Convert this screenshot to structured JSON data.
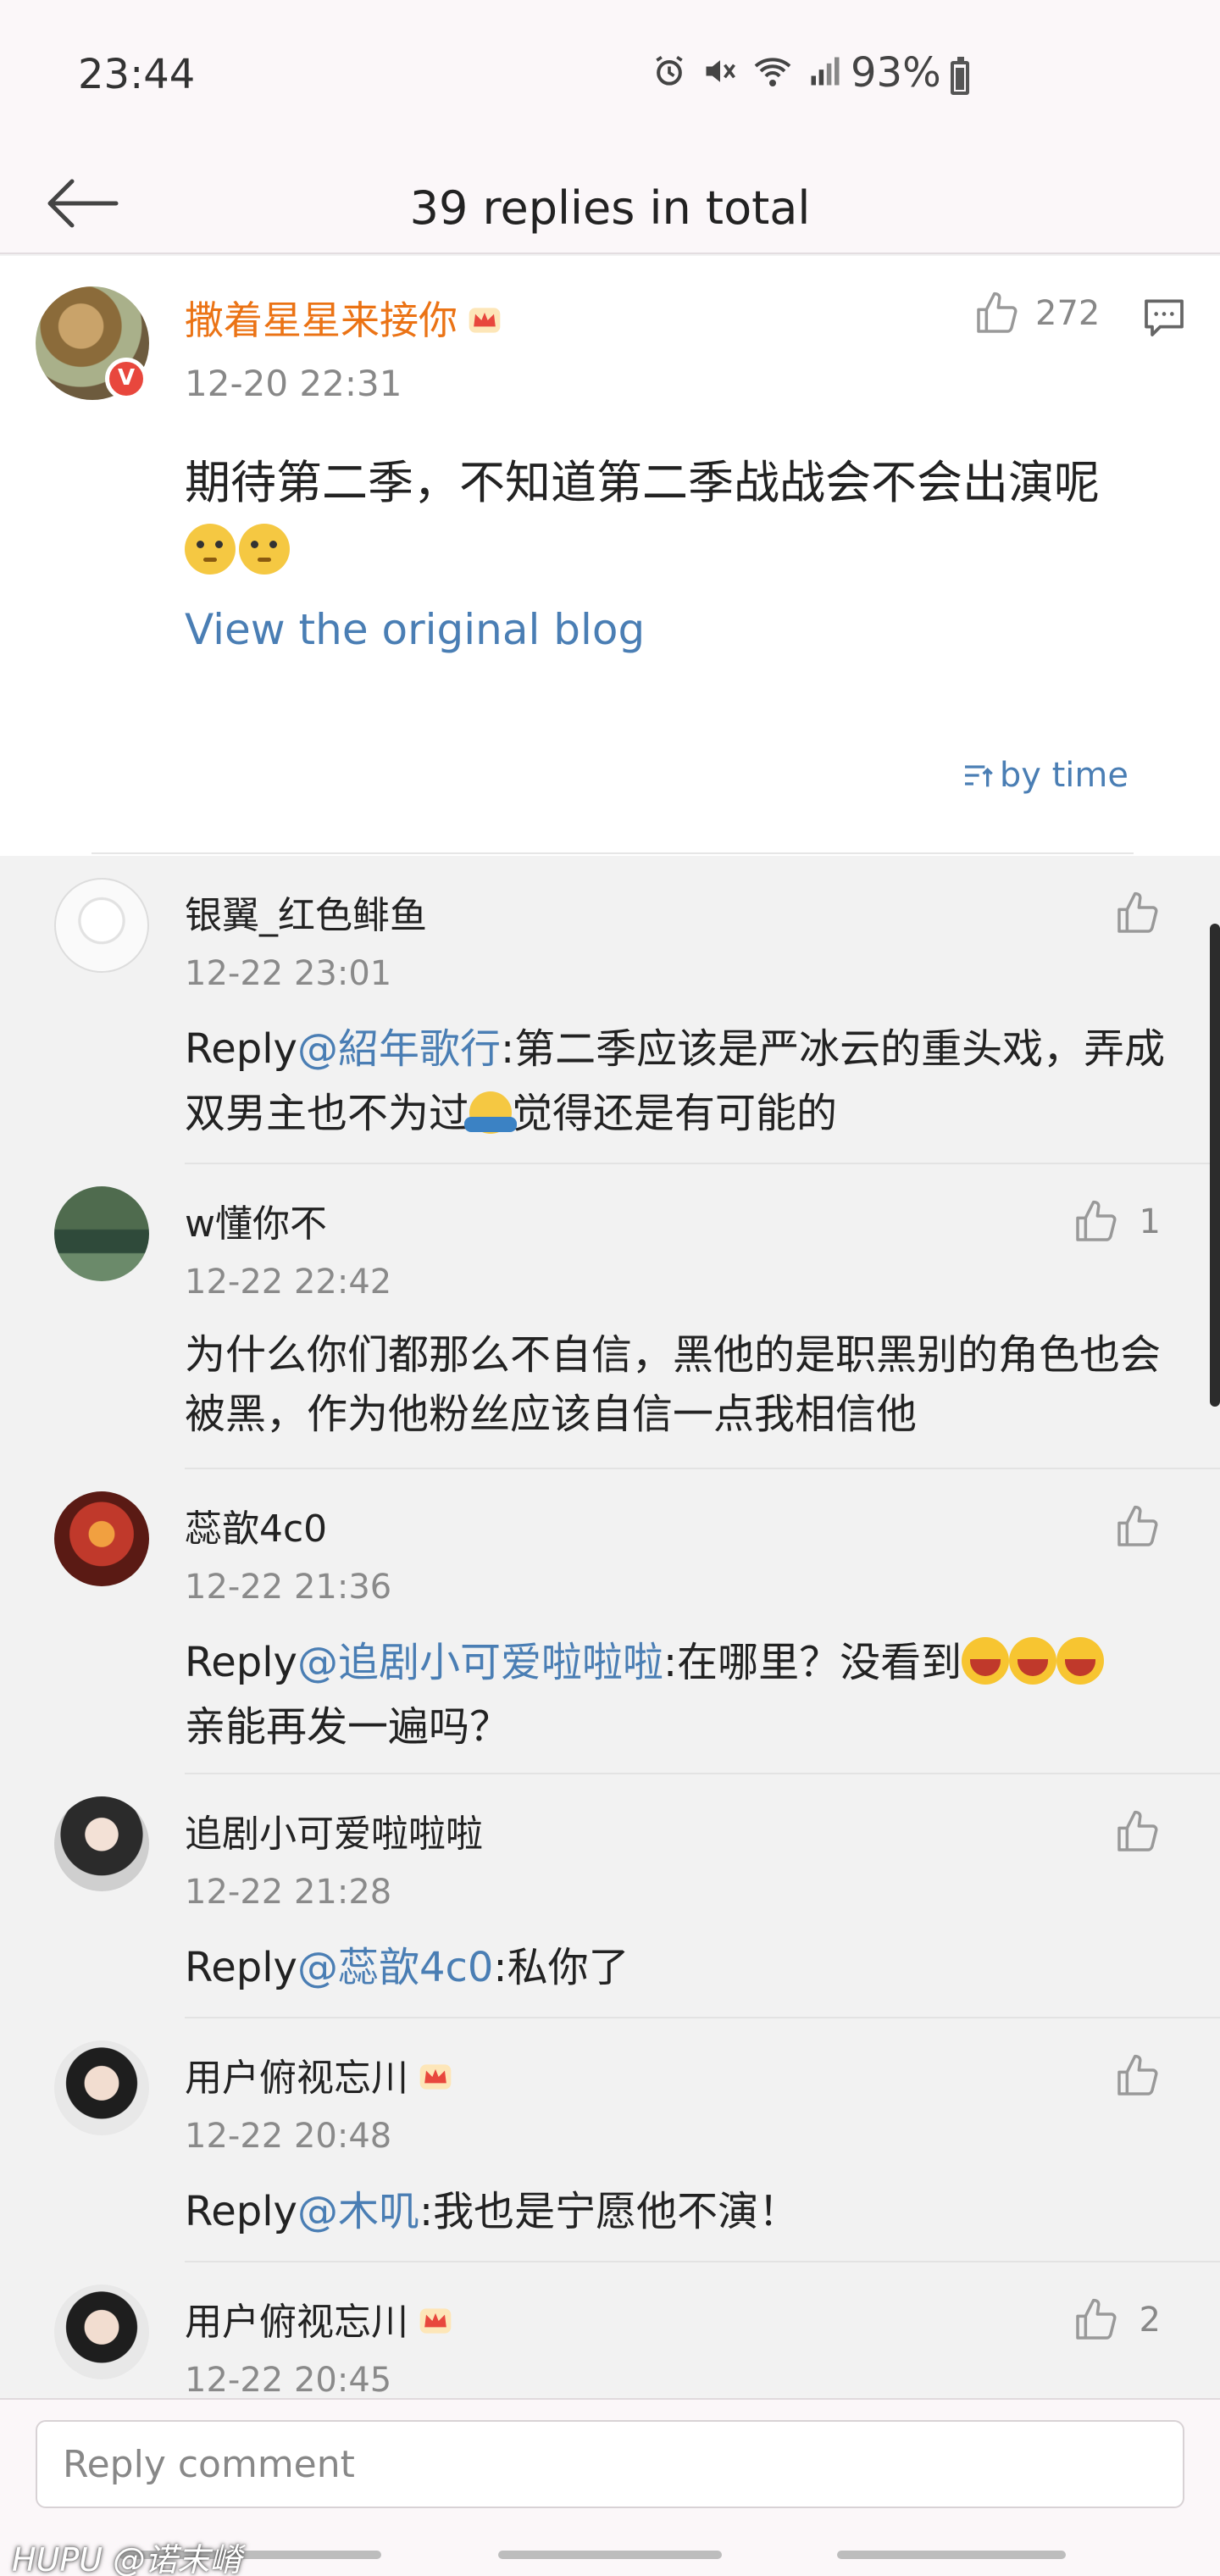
{
  "status_bar": {
    "time": "23:44",
    "battery": "93%"
  },
  "header": {
    "title": "39 replies in total"
  },
  "main_post": {
    "username": "撒着星星来接你",
    "timestamp": "12-20 22:31",
    "likes": "272",
    "text": "期待第二季，不知道第二季战战会不会出演呢",
    "view_original": "View the original blog",
    "sort_label": "by time"
  },
  "comments": [
    {
      "username": "银翼_红色鲱鱼",
      "timestamp": "12-22 23:01",
      "reply_prefix": "Reply",
      "reply_to": "@紹年歌行",
      "text_a": ":第二季应该是严冰云的重头戏，弄成双男主也不为过",
      "text_b": "觉得还是有可能的",
      "likes": ""
    },
    {
      "username": "w懂你不",
      "timestamp": "12-22 22:42",
      "text": "为什么你们都那么不自信，黑他的是职黑别的角色也会被黑，作为他粉丝应该自信一点我相信他",
      "likes": "1"
    },
    {
      "username": "蕊歆4c0",
      "timestamp": "12-22 21:36",
      "reply_prefix": "Reply",
      "reply_to": "@追剧小可爱啦啦啦",
      "text_a": ":在哪里？没看到",
      "text_b": "亲能再发一遍吗？",
      "likes": ""
    },
    {
      "username": "追剧小可爱啦啦啦",
      "timestamp": "12-22 21:28",
      "reply_prefix": "Reply",
      "reply_to": "@蕊歆4c0",
      "text_a": ":私你了",
      "likes": ""
    },
    {
      "username": "用户俯视忘川",
      "timestamp": "12-22 20:48",
      "reply_prefix": "Reply",
      "reply_to": "@木叽",
      "text_a": ":我也是宁愿他不演！",
      "likes": ""
    },
    {
      "username": "用户俯视忘川",
      "timestamp": "12-22 20:45",
      "likes": "2"
    }
  ],
  "composer": {
    "placeholder": "Reply comment"
  },
  "watermark": "HUPU @诺末嵴",
  "colors": {
    "vip_name": "#eb7315",
    "link": "#4a7eb4"
  },
  "icons": [
    "back-arrow-icon",
    "thumbs-up-icon",
    "comment-icon",
    "sort-icon",
    "verified-badge-icon",
    "crown-icon"
  ]
}
